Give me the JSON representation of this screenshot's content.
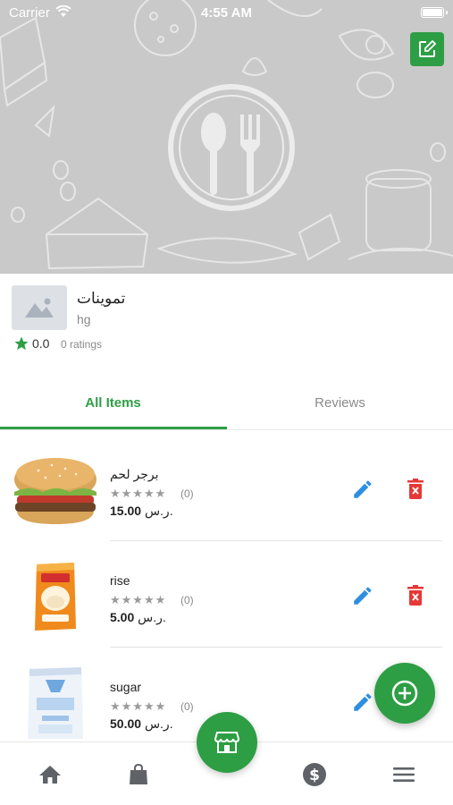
{
  "status_bar": {
    "carrier": "Carrier",
    "time": "4:55 AM"
  },
  "store": {
    "name": "تموينات",
    "subtitle": "hg",
    "rating": "0.0",
    "ratings_count": "0 ratings"
  },
  "tabs": [
    {
      "label": "All Items",
      "active": true
    },
    {
      "label": "Reviews",
      "active": false
    }
  ],
  "items": [
    {
      "name": "برجر لحم",
      "stars": "★★★★★",
      "reviews": "(0)",
      "price": "15.00",
      "currency": "ر.س.",
      "image_icon": "burger-image"
    },
    {
      "name": "rise",
      "stars": "★★★★★",
      "reviews": "(0)",
      "price": "5.00",
      "currency": "ر.س.",
      "image_icon": "rice-bag-image"
    },
    {
      "name": "sugar",
      "stars": "★★★★★",
      "reviews": "(0)",
      "price": "50.00",
      "currency": "ر.س.",
      "image_icon": "sugar-bag-image"
    }
  ],
  "colors": {
    "accent": "#2e9e45",
    "edit": "#2f8ee0",
    "delete": "#e53935",
    "header_bg": "#c9c9c9"
  },
  "icons": {
    "header": "plate-fork-spoon-icon",
    "edit_store": "edit-square-icon",
    "add": "plus-circle-icon",
    "store": "storefront-icon",
    "nav": [
      "home-icon",
      "shopping-bag-icon",
      "dollar-icon",
      "menu-icon"
    ]
  }
}
